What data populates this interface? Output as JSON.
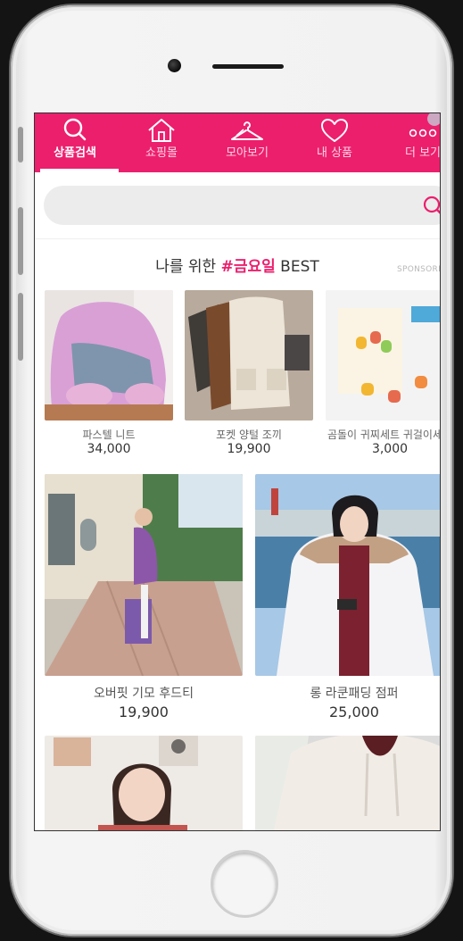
{
  "nav": {
    "items": [
      {
        "label": "상품검색",
        "icon": "search-icon",
        "active": true
      },
      {
        "label": "쇼핑몰",
        "icon": "home-icon",
        "active": false
      },
      {
        "label": "모아보기",
        "icon": "hanger-icon",
        "active": false
      },
      {
        "label": "내 상품",
        "icon": "heart-icon",
        "active": false
      },
      {
        "label": "더 보기",
        "icon": "more-icon",
        "active": false
      }
    ],
    "accent": "#ec1f6d"
  },
  "search": {
    "placeholder": "",
    "value": ""
  },
  "section": {
    "title_prefix": "나를 위한 ",
    "title_highlight": "#금요일",
    "title_suffix": " BEST",
    "sponsored": "SPONSORED"
  },
  "products_row1": [
    {
      "name": "파스텔 니트",
      "price": "34,000"
    },
    {
      "name": "포켓 양털 조끼",
      "price": "19,900"
    },
    {
      "name": "곰돌이 귀찌세트 귀걸이세트",
      "price": "3,000"
    }
  ],
  "products_row2": [
    {
      "name": "오버핏 기모 후드티",
      "price": "19,900"
    },
    {
      "name": "롱 라쿤패딩 점퍼",
      "price": "25,000"
    }
  ],
  "products_row3": [
    {
      "name": "",
      "price": ""
    },
    {
      "name": "",
      "price": ""
    }
  ]
}
